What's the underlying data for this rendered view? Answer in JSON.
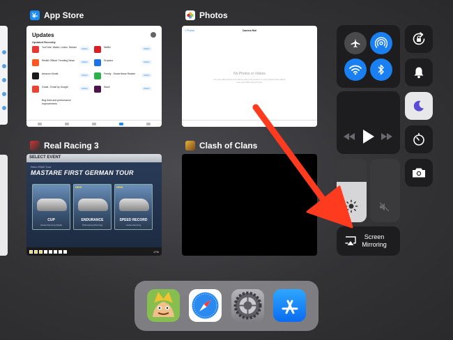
{
  "app_switcher": {
    "cards": {
      "appstore": {
        "title": "App Store",
        "screen": {
          "heading": "Updates",
          "subheading": "Updated Recently",
          "update_button": "OPEN",
          "rows": [
            {
              "left": "YouTube: Watch, Listen, Stream",
              "left_color": "#e53935",
              "right": "Netflix",
              "right_color": "#d81f26"
            },
            {
              "left": "Reddit Official: Trending News",
              "left_color": "#ff5722",
              "right": "Dropbox",
              "right_color": "#1a73e8"
            },
            {
              "left": "Amazon Kindle",
              "left_color": "#1a1a1a",
              "right": "Feedly - Smart News Reader",
              "right_color": "#2bb24c"
            },
            {
              "left": "Gmail - Email by Google",
              "left_color": "#ea4335",
              "right": "Slack",
              "right_color": "#4a154b"
            },
            {
              "left": "Bug fixes and performance improvements",
              "left_color": "#ffffff",
              "right": "",
              "right_color": "#ffffff"
            }
          ]
        }
      },
      "photos": {
        "title": "Photos",
        "screen": {
          "back": "< Photos",
          "nav_title": "Camera Roll",
          "empty_title": "No Photos or Videos",
          "empty_sub": "You can take photos and videos using the camera, or sync photos and videos onto your iPad using iTunes."
        }
      },
      "racing": {
        "title": "Real Racing 3",
        "screen": {
          "select_event": "SELECT EVENT",
          "banner": "Retro RWD Tour",
          "headline": "MASTARE FIRST GERMAN TOUR",
          "new_badge": "NEW",
          "tiles": [
            {
              "name": "CUP",
              "sub": "Hockenheimring (Night)"
            },
            {
              "name": "ENDURANCE",
              "sub": "Nürburgring (Morning)"
            },
            {
              "name": "SPEED RECORD",
              "sub": "Hockenheimring"
            }
          ],
          "progress": "17%"
        }
      },
      "clash": {
        "title": "Clash of Clans"
      }
    }
  },
  "control_center": {
    "screen_mirroring_label": "Screen Mirroring",
    "brightness_level": 0.64,
    "icons": {
      "airplane": "airplane-icon",
      "airdrop": "airdrop-icon",
      "wifi": "wifi-icon",
      "bluetooth": "bluetooth-icon",
      "rotation_lock": "rotation-lock-icon",
      "mute": "bell-icon",
      "do_not_disturb": "moon-icon",
      "timer": "timer-icon",
      "camera": "camera-icon"
    },
    "colors": {
      "active_blue": "#1a7ff0",
      "moon_purple": "#5a4ad6"
    }
  },
  "dock": {
    "apps": [
      {
        "name": "Clash of Clans"
      },
      {
        "name": "Safari"
      },
      {
        "name": "Settings"
      },
      {
        "name": "App Store"
      }
    ]
  },
  "annotation": {
    "arrow_color": "#ff3b1f"
  }
}
